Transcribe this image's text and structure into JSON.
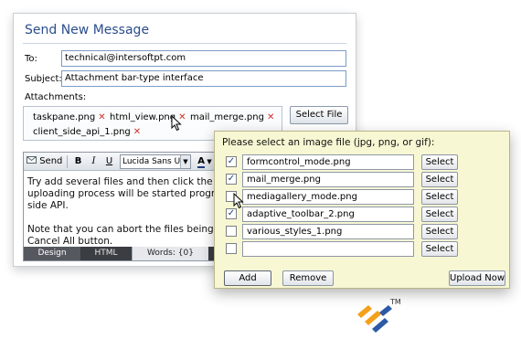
{
  "compose": {
    "title": "Send New Message",
    "to_label": "To:",
    "to_value": "technical@intersoftpt.com",
    "subject_label": "Subject:",
    "subject_value": "Attachment bar-type interface",
    "attachments_label": "Attachments:",
    "attachments": [
      {
        "name": "taskpane.png"
      },
      {
        "name": "html_view.png"
      },
      {
        "name": "mail_merge.png"
      },
      {
        "name": "client_side_api_1.png"
      }
    ],
    "select_file_label": "Select File",
    "toolbar": {
      "send_label": "Send",
      "bold_label": "B",
      "italic_label": "I",
      "underline_label": "U",
      "font_value": "Lucida Sans Uni",
      "color_label": "A"
    },
    "body_text": "Try add several files and then click the Se\nuploading process will be started program\nside API.\n\nNote that you can abort the files being up\nCancel All button.",
    "status": {
      "design_tab": "Design",
      "html_tab": "HTML",
      "words": "Words: {0}"
    }
  },
  "dialog": {
    "prompt": "Please select an image file (jpg, png, or gif):",
    "rows": [
      {
        "file": "formcontrol_mode.png",
        "checked": true,
        "select_label": "Select"
      },
      {
        "file": "mail_merge.png",
        "checked": true,
        "select_label": "Select"
      },
      {
        "file": "mediagallery_mode.png",
        "checked": false,
        "select_label": "Select"
      },
      {
        "file": "adaptive_toolbar_2.png",
        "checked": true,
        "select_label": "Select"
      },
      {
        "file": "various_styles_1.png",
        "checked": false,
        "select_label": "Select"
      },
      {
        "file": "",
        "checked": false,
        "select_label": "Select"
      }
    ],
    "add_label": "Add",
    "remove_label": "Remove",
    "upload_label": "Upload Now"
  },
  "logo": {
    "tm": "TM"
  },
  "colors": {
    "title_blue": "#2b4e8c",
    "remove_x_red": "#d0302b",
    "dialog_bg": "#f8f7d3",
    "logo_orange": "#f5a01a",
    "logo_blue": "#2d5aa6"
  },
  "icons": [
    "send-icon",
    "remove-attachment-icon",
    "font-color-icon",
    "dropdown-arrow-icon",
    "checkmark-icon",
    "mouse-cursor-icon",
    "intersoft-logo"
  ]
}
